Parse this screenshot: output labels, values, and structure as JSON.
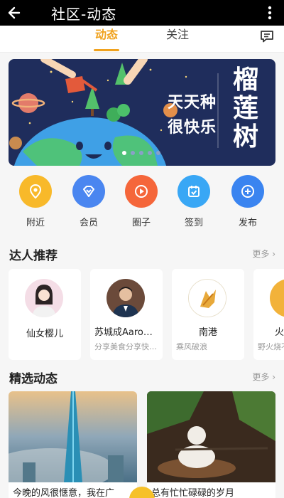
{
  "header": {
    "title": "社区-动态",
    "back_icon": "arrow-left-icon",
    "more_icon": "more-vertical-icon"
  },
  "tabs": [
    {
      "label": "动态",
      "active": true
    },
    {
      "label": "关注",
      "active": false
    }
  ],
  "message_icon": "message-icon",
  "banner": {
    "slogan_line1": "天天种",
    "slogan_line2": "很快乐",
    "brand": "榴莲树",
    "page": 1,
    "page_count": 5
  },
  "quick_actions": [
    {
      "label": "附近",
      "icon": "location-pin-icon",
      "color": "#f8b92a"
    },
    {
      "label": "会员",
      "icon": "vip-diamond-icon",
      "color": "#4a86f0"
    },
    {
      "label": "圈子",
      "icon": "circle-play-icon",
      "color": "#f5663a"
    },
    {
      "label": "签到",
      "icon": "calendar-check-icon",
      "color": "#39a7f5"
    },
    {
      "label": "发布",
      "icon": "plus-icon",
      "color": "#3a84f0"
    }
  ],
  "talents_section": {
    "title": "达人推荐",
    "more": "更多"
  },
  "talents": [
    {
      "name": "仙女樱儿",
      "desc": ""
    },
    {
      "name": "苏城成Aaron…",
      "desc": "分享美食分享快…"
    },
    {
      "name": "南港",
      "desc": "乘风破浪"
    },
    {
      "name": "火",
      "desc": "野火烧不"
    }
  ],
  "feeds_section": {
    "title": "精选动态",
    "more": "更多"
  },
  "feeds": [
    {
      "text": "今晚的风很惬意，我在广"
    },
    {
      "text": "总有忙忙碌碌的岁月"
    }
  ],
  "colors": {
    "accent": "#f0a21e",
    "banner_bg": "#1f2d5c"
  }
}
